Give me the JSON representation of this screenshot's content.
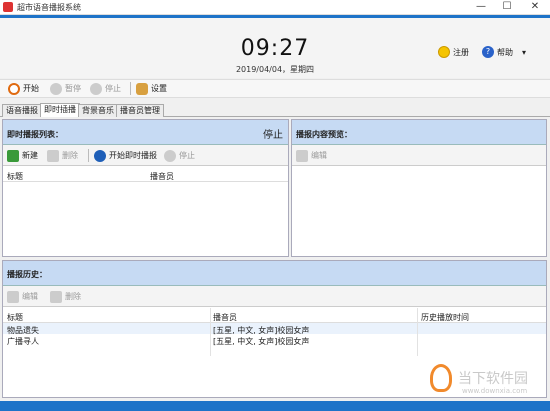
{
  "window": {
    "title": "超市语音播报系统",
    "min": "—",
    "max": "☐",
    "close": "✕"
  },
  "header": {
    "time": "09:27",
    "date": "2019/04/04，星期四",
    "register_label": "注册",
    "help_label": "帮助",
    "dropdown": "▾"
  },
  "toolbar": {
    "start_label": "开始",
    "pause_label": "暂停",
    "stop_label": "停止",
    "settings_label": "设置"
  },
  "tabs": [
    "语音播报",
    "即时插播",
    "背景音乐",
    "播音员管理"
  ],
  "list_panel": {
    "title": "即时播报列表：",
    "status": "停止",
    "new_label": "新建",
    "delete_label": "删除",
    "start_now_label": "开始即时播报",
    "stop_label": "停止",
    "col_title": "标题",
    "col_announcer": "播音员"
  },
  "preview_panel": {
    "title": "播报内容预览：",
    "edit_label": "编辑"
  },
  "history_panel": {
    "title": "播报历史：",
    "edit_label": "编辑",
    "delete_label": "删除",
    "columns": [
      "标题",
      "播音员",
      "历史播放时间"
    ],
    "rows": [
      {
        "title": "物品遗失",
        "announcer": "[五星, 中文, 女声]校园女声",
        "time": ""
      },
      {
        "title": "广播寻人",
        "announcer": "[五星, 中文, 女声]校园女声",
        "time": ""
      }
    ]
  },
  "watermark": {
    "text": "当下软件园",
    "url": "www.downxia.com"
  },
  "colors": {
    "accent": "#1e73c8",
    "panel_header": "#c6daf3"
  }
}
